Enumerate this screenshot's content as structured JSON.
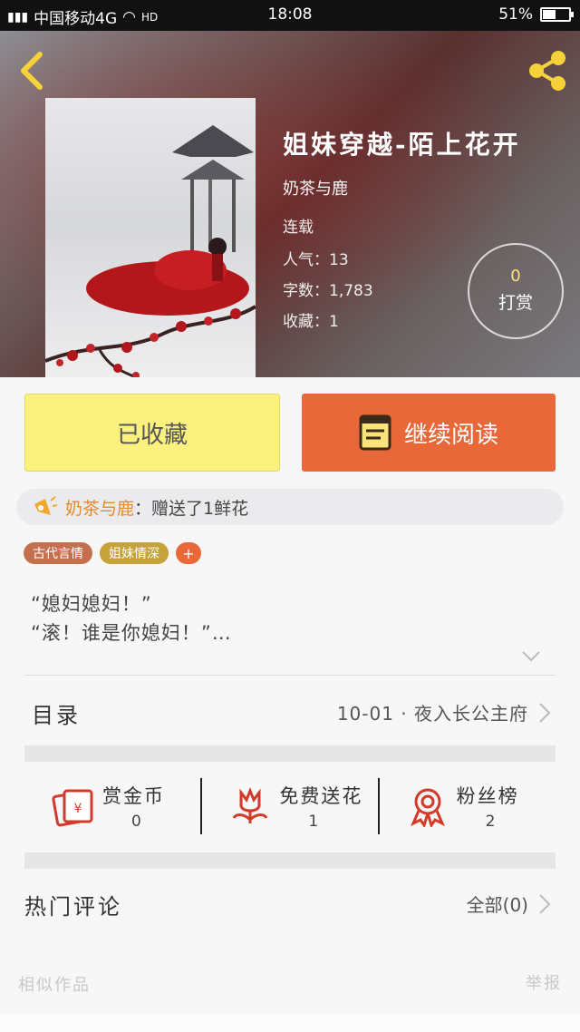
{
  "status_bar": {
    "carrier": "中国移动4G",
    "network_tag": "4G",
    "hd_tag": "HD",
    "time": "18:08",
    "battery_text": "51%",
    "battery_level": 0.51
  },
  "book": {
    "title": "姐妹穿越-陌上花开",
    "author": "奶茶与鹿",
    "status": "连载",
    "popularity": "人气：13",
    "word_count": "字数：1,783",
    "favorites": "收藏：1"
  },
  "reward": {
    "count": "0",
    "label": "打赏"
  },
  "actions": {
    "collected_label": "已收藏",
    "continue_label": "继续阅读"
  },
  "gift_banner": {
    "user": "奶茶与鹿",
    "text": "：赠送了1鲜花"
  },
  "tags": [
    "古代言情",
    "姐妹情深",
    "+"
  ],
  "intro": {
    "line1": "“媳妇媳妇！”",
    "line2": "“滚！谁是你媳妇！”…"
  },
  "catalog": {
    "label": "目录",
    "latest": "10-01 · 夜入长公主府"
  },
  "stats": [
    {
      "label": "赏金币",
      "value": "0",
      "icon": "red-envelope-icon"
    },
    {
      "label": "免费送花",
      "value": "1",
      "icon": "flower-icon"
    },
    {
      "label": "粉丝榜",
      "value": "2",
      "icon": "medal-icon"
    }
  ],
  "comments": {
    "label": "热门评论",
    "all": "全部(0)"
  },
  "footer": {
    "similar": "相似作品",
    "report": "举报"
  },
  "colors": {
    "accent_orange": "#e8683a",
    "collected_yellow": "#fbf17f",
    "gift_user": "#e58a2a",
    "share_icon": "#f5d23a"
  }
}
